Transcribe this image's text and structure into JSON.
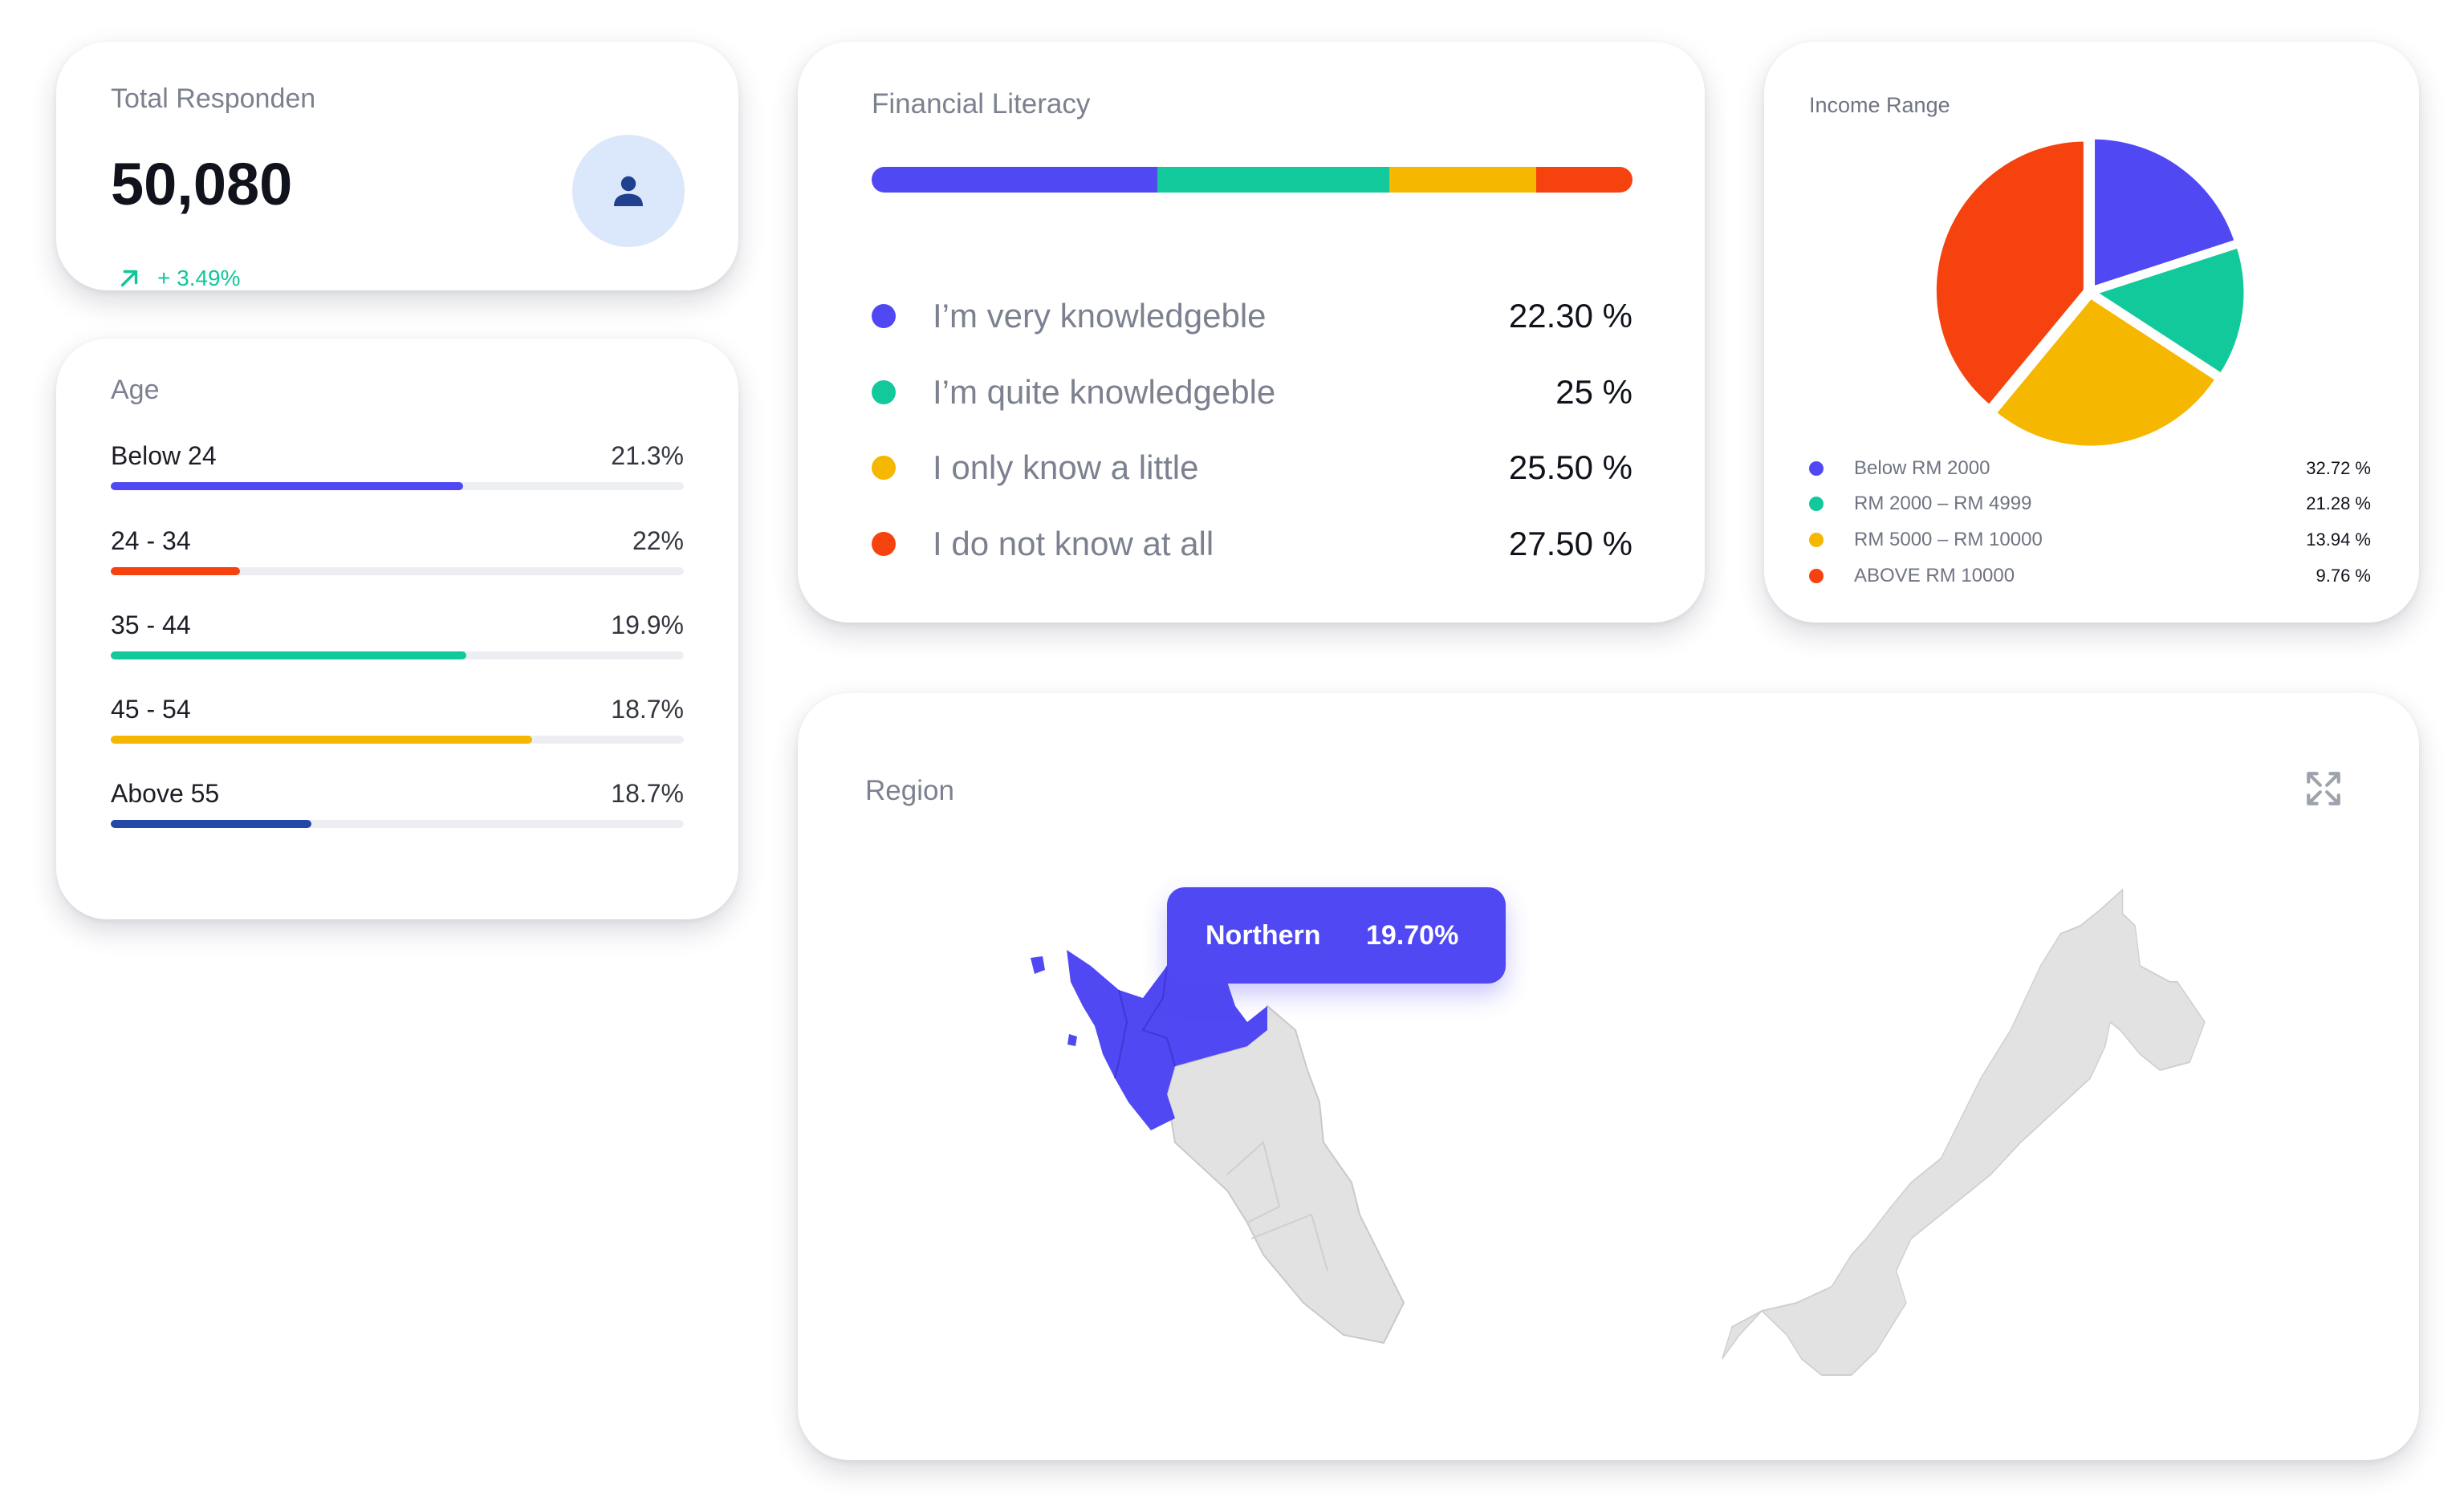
{
  "total": {
    "title": "Total Responden",
    "value": "50,080",
    "change": "+ 3.49%",
    "icons": {
      "trend": "arrow-up-right-icon",
      "avatar": "user-icon"
    }
  },
  "age": {
    "title": "Age",
    "groups": [
      {
        "label": "Below 24",
        "value": "21.3%",
        "fill_fraction": 0.615,
        "color": "#5048f3"
      },
      {
        "label": "24 - 34",
        "value": "22%",
        "fill_fraction": 0.225,
        "color": "#f5420e"
      },
      {
        "label": "35 - 44",
        "value": "19.9%",
        "fill_fraction": 0.62,
        "color": "#12c99b"
      },
      {
        "label": "45 - 54",
        "value": "18.7%",
        "fill_fraction": 0.735,
        "color": "#f5b700"
      },
      {
        "label": "Above 55",
        "value": "18.7%",
        "fill_fraction": 0.35,
        "color": "#2348a8"
      }
    ]
  },
  "literacy": {
    "title": "Financial Literacy",
    "items": [
      {
        "label": "I’m very knowledgeble",
        "value": "22.30 %",
        "color": "#5048f3",
        "bar_fraction": 0.375
      },
      {
        "label": "I’m quite knowledgeble",
        "value": "25 %",
        "color": "#12c99b",
        "bar_fraction": 0.305
      },
      {
        "label": "I only know a little",
        "value": "25.50 %",
        "color": "#f5b700",
        "bar_fraction": 0.193
      },
      {
        "label": "I do not know at all",
        "value": "27.50 %",
        "color": "#f5420e",
        "bar_fraction": 0.127
      }
    ]
  },
  "income": {
    "title": "Income Range",
    "chart_data": {
      "type": "pie",
      "categories": [
        "Below RM 2000",
        "RM 2000 – RM 4999",
        "RM 5000 – RM 10000",
        "ABOVE RM 10000"
      ],
      "values": [
        32.72,
        21.28,
        13.94,
        9.76
      ],
      "labels": [
        "32.72 %",
        "21.28 %",
        "13.94 %",
        "9.76 %"
      ],
      "colors": [
        "#5048f3",
        "#12c99b",
        "#f5b700",
        "#f5420e"
      ],
      "slice_fractions": [
        0.2,
        0.142,
        0.268,
        0.39
      ]
    }
  },
  "region": {
    "title": "Region",
    "tooltip": {
      "name": "Northern",
      "value": "19.70%"
    },
    "highlight_color": "#5048f3",
    "land_color": "#e2e2e2",
    "icons": {
      "expand": "expand-icon"
    }
  }
}
